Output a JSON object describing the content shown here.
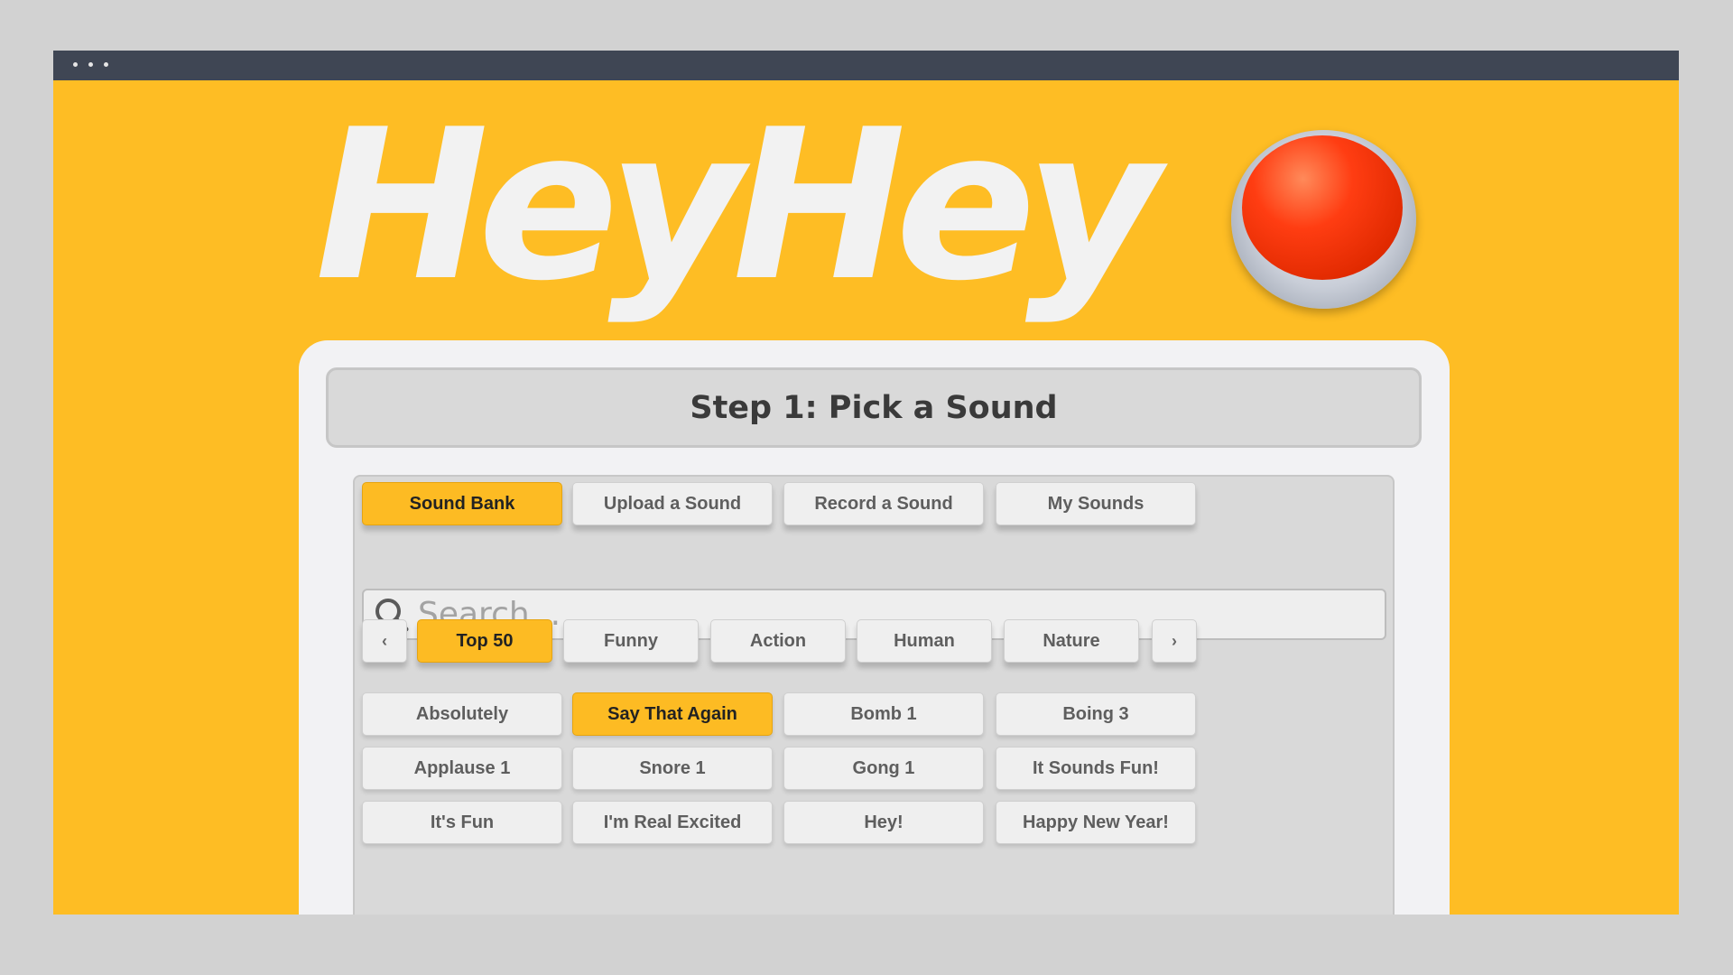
{
  "app": {
    "logo_text": "HeyHey"
  },
  "step": {
    "title": "Step 1: Pick a Sound"
  },
  "source_tabs": [
    {
      "label": "Sound Bank",
      "active": true
    },
    {
      "label": "Upload a Sound",
      "active": false
    },
    {
      "label": "Record a Sound",
      "active": false
    },
    {
      "label": "My Sounds",
      "active": false
    }
  ],
  "search": {
    "placeholder": "Search...",
    "value": ""
  },
  "categories": {
    "prev_label": "‹",
    "next_label": "›",
    "items": [
      {
        "label": "Top 50",
        "active": true
      },
      {
        "label": "Funny",
        "active": false
      },
      {
        "label": "Action",
        "active": false
      },
      {
        "label": "Human",
        "active": false
      },
      {
        "label": "Nature",
        "active": false
      }
    ]
  },
  "sounds": [
    {
      "label": "Absolutely",
      "selected": false
    },
    {
      "label": "Say That Again",
      "selected": true
    },
    {
      "label": "Bomb 1",
      "selected": false
    },
    {
      "label": "Boing 3",
      "selected": false
    },
    {
      "label": "Applause 1",
      "selected": false
    },
    {
      "label": "Snore 1",
      "selected": false
    },
    {
      "label": "Gong 1",
      "selected": false
    },
    {
      "label": "It Sounds Fun!",
      "selected": false
    },
    {
      "label": "It's Fun",
      "selected": false
    },
    {
      "label": "I'm Real Excited",
      "selected": false
    },
    {
      "label": "Hey!",
      "selected": false
    },
    {
      "label": "Happy New Year!",
      "selected": false
    }
  ],
  "colors": {
    "background": "#febd24",
    "accent": "#fdbb23",
    "titlebar": "#3f4654",
    "logo_button": "#ff3d12"
  }
}
